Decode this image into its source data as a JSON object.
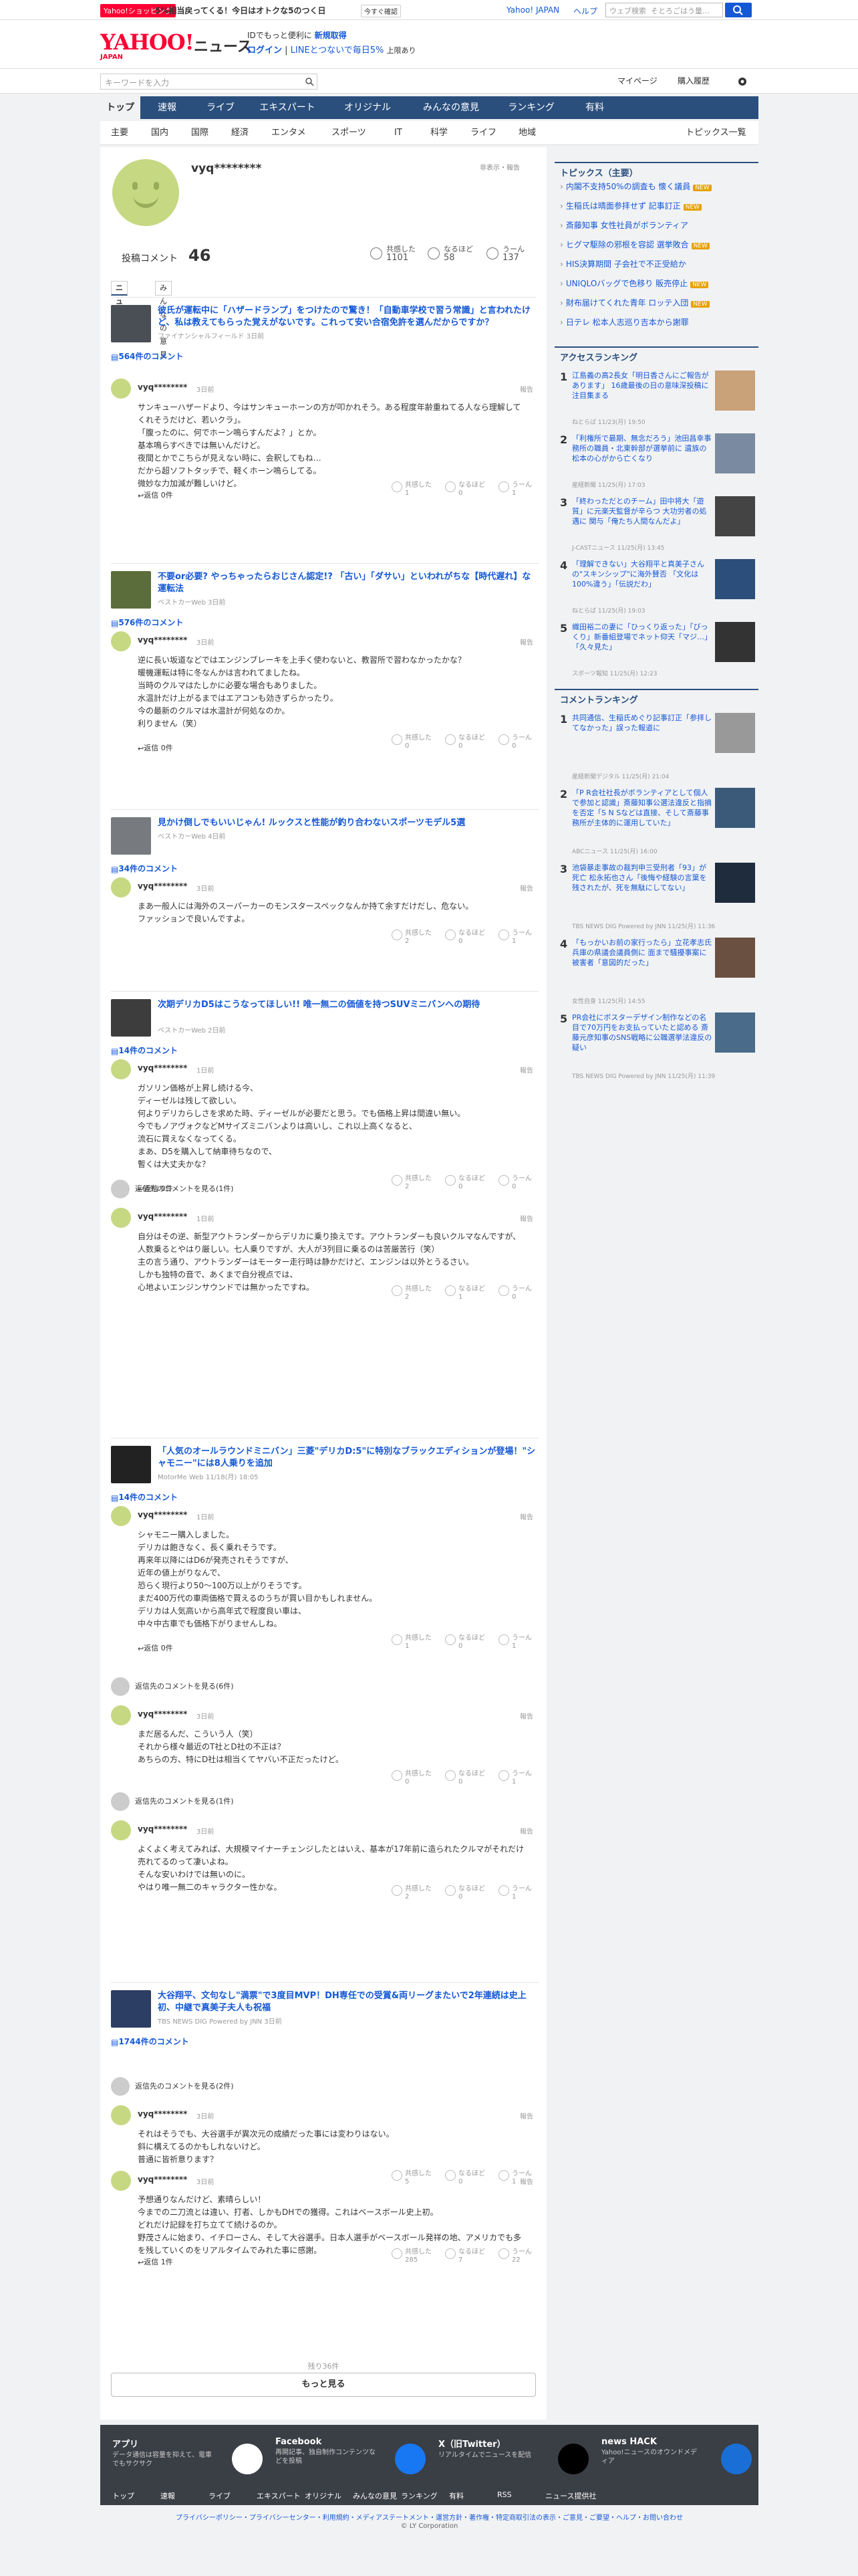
{
  "strip": {
    "shop": "Yahoo!ショッピング",
    "promo": "5%相当戻ってくる！今日はオトクな5のつく日",
    "badge": "今すぐ確認",
    "link1": "Yahoo! JAPAN",
    "link2": "ヘルプ",
    "search_ph": "ウェブ検索",
    "search_val": "そとろごはう量…"
  },
  "header": {
    "logo": "YAHOO!",
    "logo_sub": "JAPAN",
    "title": "ニュース",
    "line1a": "IDでもっと便利に",
    "line1b": "新規取得",
    "line2a": "ログイン",
    "line2b": "LINEとつないで毎日5%",
    "line2c": "上限あり"
  },
  "search": {
    "placeholder": "キーワードを入力",
    "mypage": "マイページ",
    "history": "購入履歴"
  },
  "nav": [
    "トップ",
    "速報",
    "ライブ",
    "エキスパート",
    "オリジナル",
    "みんなの意見",
    "ランキング",
    "有料"
  ],
  "subnav": [
    "主要",
    "国内",
    "国際",
    "経済",
    "エンタメ",
    "スポーツ",
    "IT",
    "科学",
    "ライフ",
    "地域"
  ],
  "subnav_right": "トピックス一覧",
  "profile": {
    "name": "vyq********",
    "private": "非表示・報告",
    "post_label": "投稿コメント",
    "post_count": "46",
    "reactions": [
      {
        "label": "共感した",
        "count": "1101"
      },
      {
        "label": "なるほど",
        "count": "58"
      },
      {
        "label": "うーん",
        "count": "137"
      }
    ],
    "tabs": [
      "ニュース",
      "みんなの意見"
    ]
  },
  "articles": [
    {
      "title": "彼氏が運転中に「ハザードランプ」をつけたので驚き！「自動車学校で習う常識」と言われたけど、私は教えてもらった覚えがないです。これって安い合宿免許を選んだからですか？",
      "source": "ファイナンシャルフィールド 3日前",
      "count": "564件のコメント",
      "thumb": "#4a4f56",
      "comments": [
        {
          "name": "vyq********",
          "time": "3日前",
          "report": "報告",
          "body": "サンキューハザードより、今はサンキューホーンの方が叩かれそう。ある程度年齢重ねてる人なら理解してくれそうだけど、若いクラ」。\n「腹ったのに、何でホーン鳴らすんだよ？」とか。\n基本鳴らすべきでは無いんだけど。\n夜間とかでこちらが見えない時に、会釈してもね…\nだから超ソフトタッチで、軽くホーン鳴らしてる。\n微妙な力加減が難しいけど。",
          "reply": "返信 0件",
          "r": [
            "1",
            "0",
            "1"
          ]
        }
      ]
    },
    {
      "title": "不要or必要? やっちゃったらおじさん認定!? 「古い」「ダサい」といわれがちな【時代遅れ】な運転法",
      "source": "ベストカーWeb 3日前",
      "count": "576件のコメント",
      "thumb": "#5b6d3a",
      "comments": [
        {
          "name": "vyq********",
          "time": "3日前",
          "report": "報告",
          "body": "逆に長い坂道などではエンジンブレーキを上手く使わないと、教習所で習わなかったかな？\n暖機運転は特に冬なんかは言われてましたね。\n当時のクルマはたしかに必要な場合もありました。\n水温計だけ上がるまではエアコンも効きずらかったり。\n今の最新のクルマは水温計が何処なのか。\n利りません（笑）",
          "reply": "返信 0件",
          "r": [
            "0",
            "0",
            "0"
          ]
        }
      ]
    },
    {
      "title": "見かけ倒しでもいいじゃん! ルックスと性能が釣り合わないスポーツモデル5選",
      "source": "ベストカーWeb 4日前",
      "count": "34件のコメント",
      "thumb": "#777b80",
      "comments": [
        {
          "name": "vyq********",
          "time": "3日前",
          "report": "報告",
          "body": "まあ一般人には海外のスーパーカーのモンスタースペックなんか持て余すだけだし、危ない。\nファッションで良いんですよ。",
          "reply": "",
          "r": [
            "2",
            "0",
            "1"
          ]
        }
      ]
    },
    {
      "title": "次期デリカD5はこうなってほしい!! 唯一無二の価値を持つSUVミニバンへの期待",
      "source": "ベストカーWeb 2日前",
      "count": "14件のコメント",
      "thumb": "#3d3d3d",
      "comments": [
        {
          "name": "vyq********",
          "time": "1日前",
          "report": "報告",
          "body": "ガソリン価格が上昇し続ける今、\nディーゼルは残して欲しい。\n何よりデリカらしさを求めた時、ディーゼルが必要だと思う。でも価格上昇は間違い無い。\n今でもノアヴォクなどMサイズミニバンよりは高いし、これ以上高くなると、\n流石に買えなくなってくる。\nまあ、D5を購入して納車待ちなので、\n暫くは大丈夫かな？",
          "reply": "返信 0件",
          "r": [
            "2",
            "0",
            "0"
          ]
        },
        {
          "name": "vyq********",
          "time": "1日前",
          "report": "報告",
          "body": "自分はその逆、新型アウトランダーからデリカに乗り換えです。アウトランダーも良いクルマなんですが、人数乗るとやはり厳しい。七人乗りですが、大人が3列目に乗るのは苦厳苦行（笑）\n主の言う通り、アウトランダーはモーター走行時は静かだけど、エンジンは以外とうるさい。\nしかも独特の音で、あくまで自分視点では、\n心地よいエンジンサウンドでは無かったですね。",
          "reply": "",
          "r": [
            "2",
            "1",
            "0"
          ],
          "header": "返信先のコメントを見る(1件)"
        }
      ]
    },
    {
      "title": "「人気のオールラウンドミニバン」三菱\"デリカD:5\"に特別なブラックエディションが登場！\"シャモニー\"には8人乗りを追加",
      "source": "MotorMe Web 11/18(月) 18:05",
      "count": "14件のコメント",
      "thumb": "#222",
      "comments": [
        {
          "name": "vyq********",
          "time": "1日前",
          "report": "報告",
          "body": "シャモニー購入しました。\nデリカは飽きなく、長く乗れそうです。\n再来年以降にはD6が発売されそうですが、\n近年の値上がりなんで、\n恐らく現行より50〜100万以上がりそうです。\nまだ400万代の車両価格で買えるのうちが買い目かもしれません。\nデリカは人気高いから高年式で程度良い車は、\n中々中古車でも価格下がりませんしね。",
          "reply": "返信 0件",
          "r": [
            "1",
            "0",
            "1"
          ]
        },
        {
          "name": "vyq********",
          "time": "3日前",
          "report": "報告",
          "body": "まだ居るんだ、こういう人（笑）\nそれから様々最近のT社とD社の不正は？\nあちらの方、特にD社は相当くてヤバい不正だったけど。",
          "reply": "",
          "r": [
            "0",
            "0",
            "1"
          ],
          "header": "返信先のコメントを見る(6件)"
        },
        {
          "name": "vyq********",
          "time": "3日前",
          "report": "報告",
          "body": "よくよく考えてみれば、大規模マイナーチェンジしたとはいえ、基本が17年前に造られたクルマがそれだけ売れてるのって凄いよね。\nそんな安いわけでは無いのに。\nやはり唯一無二のキャラクター性かな。",
          "reply": "",
          "r": [
            "2",
            "0",
            "1"
          ],
          "header": "返信先のコメントを見る(1件)"
        }
      ]
    },
    {
      "title": "大谷翔平、文句なし\"満票\"で3度目MVP！DH専任での受賞&両リーグまたいで2年連続は史上初、中継で真美子夫人も祝福",
      "source": "TBS NEWS DIG Powered by JNN 3日前",
      "count": "1744件のコメント",
      "thumb": "#2c3e63",
      "comments": [
        {
          "name": "vyq********",
          "time": "3日前",
          "report": "報告",
          "body": "それはそうでも、大谷選手が異次元の成績だった事には変わりはない。\n斜に構えてるのかもしれないけど。\n普通に皆祈意ります？",
          "reply": "",
          "r": [
            "5",
            "0",
            "1"
          ],
          "header": "返信先のコメントを見る(2件)"
        },
        {
          "name": "vyq********",
          "time": "3日前",
          "report": "報告",
          "body": "予想通りなんだけど、素晴らしい！\n今までの二刀流とは違い、打者、しかもDHでの獲得。これはベースボール史上初。\nどれだけ記録を打ち立てて続けるのか。\n野茂さんに始まり、イチローさん、そして大谷選手。日本人選手がベースボール発祥の地、アメリカでも多を残していくのをリアルタイムでみれた事に感謝。",
          "reply": "返信 1件",
          "r": [
            "285",
            "7",
            "22"
          ]
        }
      ]
    }
  ],
  "more": {
    "remain": "残り36件",
    "button": "もっと見る"
  },
  "sidebar": {
    "topics_title": "トピックス（主要）",
    "topics": [
      {
        "t": "内閣不支持50%の調査も 懐く議員",
        "new": "NEW"
      },
      {
        "t": "生稲氏は晴面参拝せず 記事訂正",
        "new": "NEW"
      },
      {
        "t": "斎藤知事 女性社員がボランティア",
        "new": ""
      },
      {
        "t": "ヒグマ駆除の邪根を容認 選挙敗合",
        "new": "NEW"
      },
      {
        "t": "HIS決算期間 子会社で不正受給か",
        "new": ""
      },
      {
        "t": "UNIQLOバッグで色移り 販売停止",
        "new": "NEW"
      },
      {
        "t": "財布届けてくれた青年 ロッテ入団",
        "new": "NEW"
      },
      {
        "t": "日テレ 松本人志巡り吉本から謝罪",
        "new": ""
      }
    ],
    "access_title": "アクセスランキング",
    "access": [
      {
        "n": "1",
        "t": "江島義の高2長女「明日香さんにご報告があります」 16歳最後の日の意味深投稿に注目集まる",
        "m": "ねとらば 11/23(月) 19:50",
        "c": "#c9a27a"
      },
      {
        "n": "2",
        "t": "「利権所で最期、無念だろう」池田昌幸事務所の職員・北東幹部が選挙前に 遺族の松本の心がから亡くなり",
        "m": "産経新聞 11/25(月) 17:03",
        "c": "#7a8ba1"
      },
      {
        "n": "3",
        "t": "「終わっただとのチーム」田中将大「遊質」に元楽天監督が辛らつ 大功労者の処遇に 関与「俺たち人間なんだよ」",
        "m": "J-CASTニュース 11/25(月) 13:45",
        "c": "#444"
      },
      {
        "n": "4",
        "t": "「理解できない」大谷翔平と真美子さんの\"スキンシップ\"に海外賛否 「文化は100%違う」「伝説だわ」",
        "m": "ねとらば 11/25(月) 19:03",
        "c": "#2b4e7a"
      },
      {
        "n": "5",
        "t": "織田裕二の妻に「ひっくり返った」「びっくり」新番組登場でネット仰天「マジ…」「久々見た」",
        "m": "スポーツ報知 11/25(月) 12:23",
        "c": "#333"
      }
    ],
    "comment_title": "コメントランキング",
    "comments": [
      {
        "n": "1",
        "t": "共同通信、生稲氏めぐり記事訂正「参拝してなかった」誤った報道に",
        "m": "産経新聞デジタル 11/25(月) 21:04",
        "c": "#999"
      },
      {
        "n": "2",
        "t": "「P R会社社長がボランティアとして個人で参加と認識」斎藤知事公選法違反と指摘を否定「S N Sなどは直接、そして斎藤事務所が主体的に運用していた」",
        "m": "ABCニュース 11/25(月) 16:00",
        "c": "#3b5a7a"
      },
      {
        "n": "3",
        "t": "池袋暴走事故の裁判申三受刑者「93」が死亡 松永拓也さん「後悔や経験の言葉を残されたが、死を無駄にしてない」",
        "m": "TBS NEWS DIG Powered by JNN 11/25(月) 11:36",
        "c": "#1e2c3d"
      },
      {
        "n": "4",
        "t": "「もっかいお前の家行ったら」立花孝志氏 兵庫の県議会議員側に 面まで騒擾事案に被害者「意図的だった」",
        "m": "女性自身 11/25(月) 14:55",
        "c": "#6a5040"
      },
      {
        "n": "5",
        "t": "PR会社にボスターデザイン制作などの名目で70万円をお支払っていたと認める 斎藤元彦知事のSNS戦略に公職選挙法違反の疑い",
        "m": "TBS NEWS DIG Powered by JNN 11/25(月) 11:39",
        "c": "#4a6b8a"
      }
    ]
  },
  "footer": {
    "boxes": [
      {
        "h": "アプリ",
        "d": "データ通信は容量を抑えて、電車でもサクサク"
      },
      {
        "h": "Facebook",
        "d": "再開記事、独自制作コンテンツなどを投稿"
      },
      {
        "h": "X（旧Twitter）",
        "d": "リアルタイムでニュースを配信"
      },
      {
        "h": "news HACK",
        "d": "Yahoo!ニュースのオウンドメディア"
      }
    ],
    "nav": [
      "トップ",
      "速報",
      "ライブ",
      "エキスパート",
      "オリジナル",
      "みんなの意見",
      "ランキング",
      "有料",
      "RSS",
      "ニュース提供社"
    ],
    "links": "プライバシーポリシー・プライバシーセンター・利用規約・メディアステートメント・運営方針・著作権・特定商取引法の表示・ご意見・ご要望・ヘルプ・お問い合わせ",
    "copy": "© LY Corporation"
  },
  "colors": {
    "brand": "#ff0033",
    "nav": "#2a4f7d",
    "link": "#1558d6",
    "avatar": "#c6d882"
  }
}
